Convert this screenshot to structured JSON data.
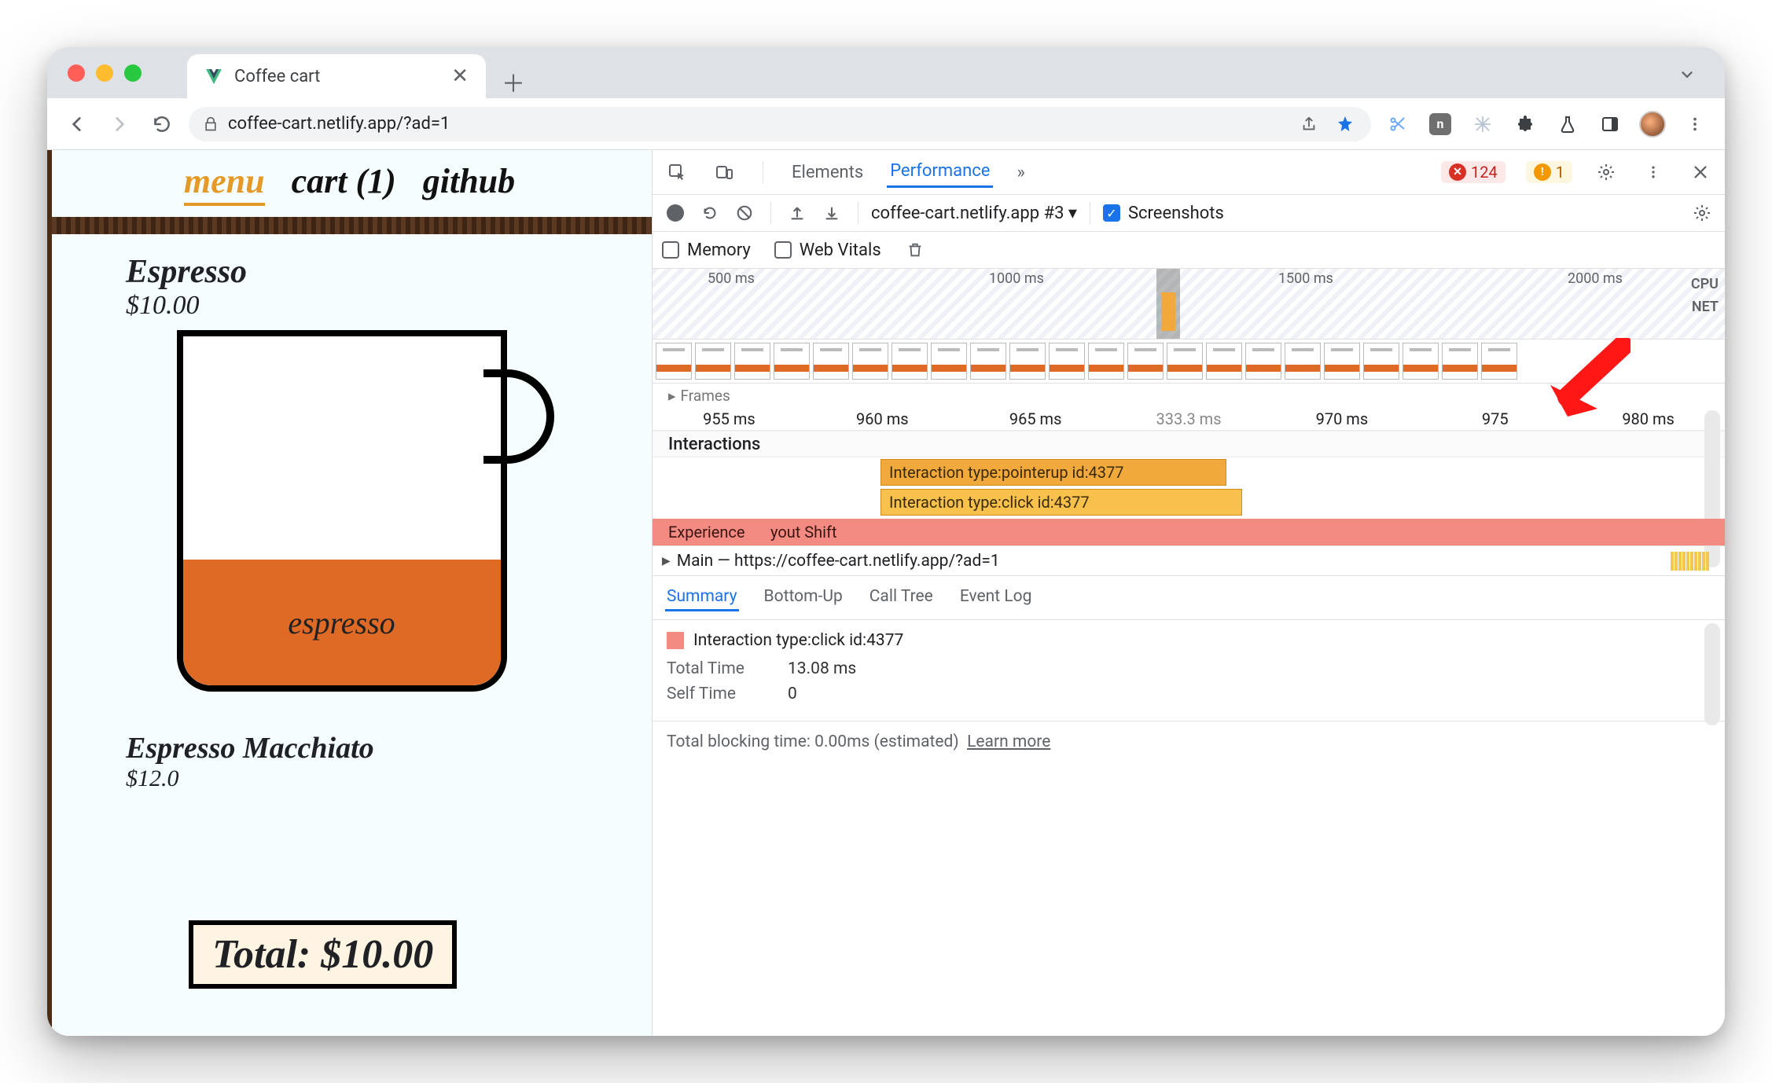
{
  "browser": {
    "tab_title": "Coffee cart",
    "url_display": "coffee-cart.netlify.app/?ad=1"
  },
  "page": {
    "nav": {
      "menu": "menu",
      "cart": "cart (1)",
      "github": "github"
    },
    "product1": {
      "name": "Espresso",
      "price": "$10.00",
      "fill_label": "espresso"
    },
    "product2": {
      "name": "Espresso Macchiato",
      "price": "$12.0"
    },
    "total_label": "Total: $10.00"
  },
  "devtools": {
    "tabs": {
      "elements": "Elements",
      "performance": "Performance",
      "more_glyph": "»"
    },
    "counts": {
      "errors": "124",
      "warnings": "1"
    },
    "perf_toolbar": {
      "dropdown": "coffee-cart.netlify.app #3",
      "screenshots": "Screenshots",
      "memory": "Memory",
      "webvitals": "Web Vitals"
    },
    "overview": {
      "ticks": [
        "500 ms",
        "1000 ms",
        "1500 ms",
        "2000 ms"
      ],
      "cpu": "CPU",
      "net": "NET"
    },
    "ruler": [
      "955 ms",
      "960 ms",
      "965 ms",
      "333.3 ms",
      "970 ms",
      "975",
      "980 ms"
    ],
    "frames_label": "Frames",
    "interactions_label": "Interactions",
    "bars": {
      "b1": "Interaction type:pointerup id:4377",
      "b2": "Interaction type:click id:4377"
    },
    "experience_label": "Experience",
    "experience_text": "yout Shift",
    "main_label": "Main — https://coffee-cart.netlify.app/?ad=1",
    "tabs2": {
      "summary": "Summary",
      "bottomup": "Bottom-Up",
      "calltree": "Call Tree",
      "eventlog": "Event Log"
    },
    "summary": {
      "title": "Interaction type:click id:4377",
      "total_time_k": "Total Time",
      "total_time_v": "13.08 ms",
      "self_time_k": "Self Time",
      "self_time_v": "0"
    },
    "totals": {
      "text": "Total blocking time: 0.00ms (estimated)",
      "link": "Learn more"
    }
  }
}
